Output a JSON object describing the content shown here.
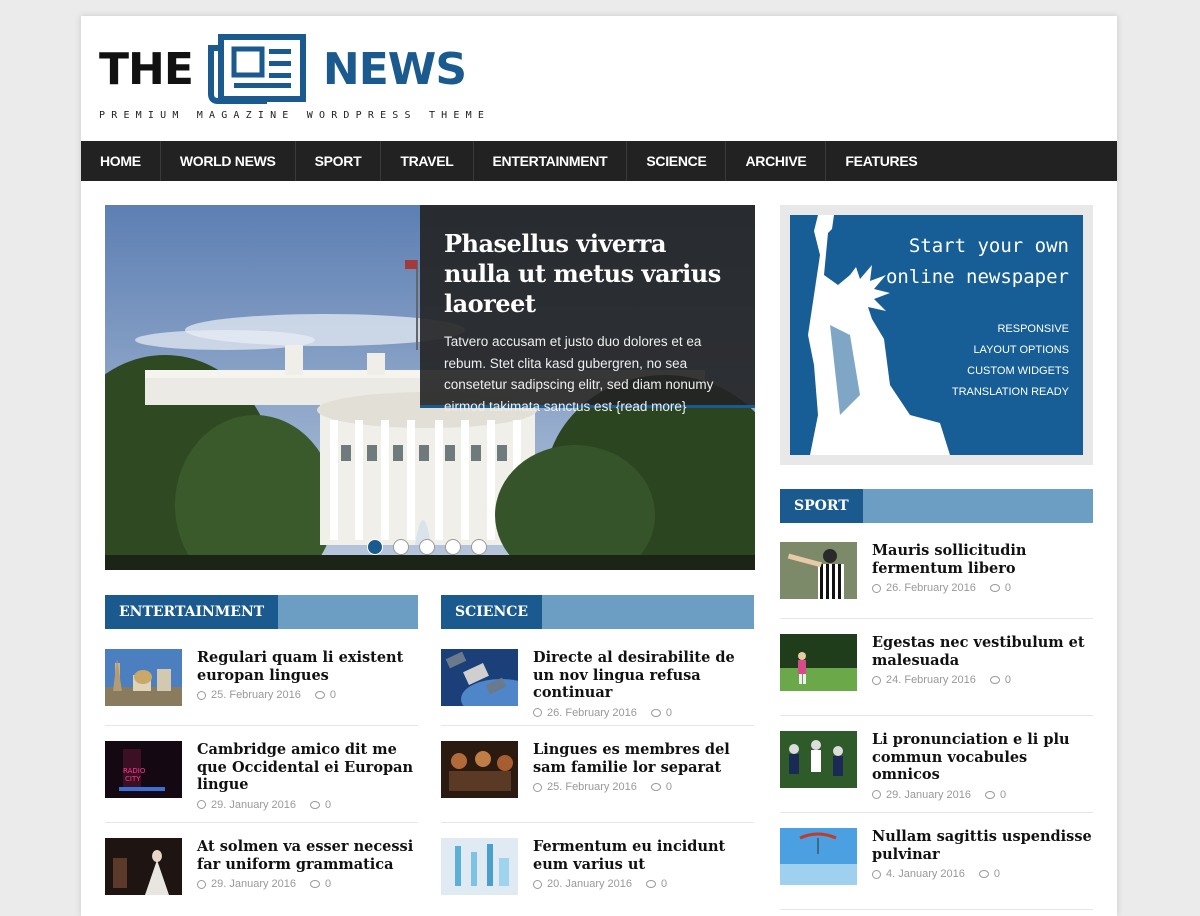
{
  "header": {
    "logo_the": "THE",
    "logo_news": "NEWS",
    "tagline": "PREMIUM MAGAZINE WORDPRESS THEME"
  },
  "nav": [
    "HOME",
    "WORLD NEWS",
    "SPORT",
    "TRAVEL",
    "ENTERTAINMENT",
    "SCIENCE",
    "ARCHIVE",
    "FEATURES"
  ],
  "slider": {
    "title": "Phasellus viverra nulla ut metus varius laoreet",
    "excerpt": "Tatvero accusam et justo duo dolores et ea rebum. Stet clita kasd gubergren, no sea consetetur sadipscing elitr, sed diam nonumy eirmod takimata sanctus est {read more}",
    "slide_count": 5,
    "active_slide": 1
  },
  "ad": {
    "line1": "Start your own",
    "line2": "online newspaper",
    "features": [
      "RESPONSIVE",
      "LAYOUT OPTIONS",
      "CUSTOM WIDGETS",
      "TRANSLATION READY"
    ]
  },
  "entertainment": {
    "label": "ENTERTAINMENT",
    "posts": [
      {
        "title": "Regulari quam li existent europan lingues",
        "date": "25. February 2016",
        "comments": "0"
      },
      {
        "title": "Cambridge amico dit me que Occidental ei Europan lingue",
        "date": "29. January 2016",
        "comments": "0"
      },
      {
        "title": "At solmen va esser necessi far uniform grammatica",
        "date": "29. January 2016",
        "comments": "0"
      }
    ]
  },
  "science": {
    "label": "SCIENCE",
    "posts": [
      {
        "title": "Directe al desirabilite de un nov lingua refusa continuar",
        "date": "26. February 2016",
        "comments": "0"
      },
      {
        "title": "Lingues es membres del sam familie lor separat",
        "date": "25. February 2016",
        "comments": "0"
      },
      {
        "title": "Fermentum eu incidunt eum varius ut",
        "date": "20. January 2016",
        "comments": "0"
      }
    ]
  },
  "sport": {
    "label": "SPORT",
    "posts": [
      {
        "title": "Mauris sollicitudin fermentum libero",
        "date": "26. February 2016",
        "comments": "0"
      },
      {
        "title": "Egestas nec vestibulum et malesuada",
        "date": "24. February 2016",
        "comments": "0"
      },
      {
        "title": "Li pronunciation e li plu commun vocabules omnicos",
        "date": "29. January 2016",
        "comments": "0"
      },
      {
        "title": "Nullam sagittis uspendisse pulvinar",
        "date": "4. January 2016",
        "comments": "0"
      }
    ]
  },
  "colors": {
    "brand": "#1a5a8e",
    "widget_bar": "#6b9ec2",
    "nav_bg": "#222222"
  }
}
